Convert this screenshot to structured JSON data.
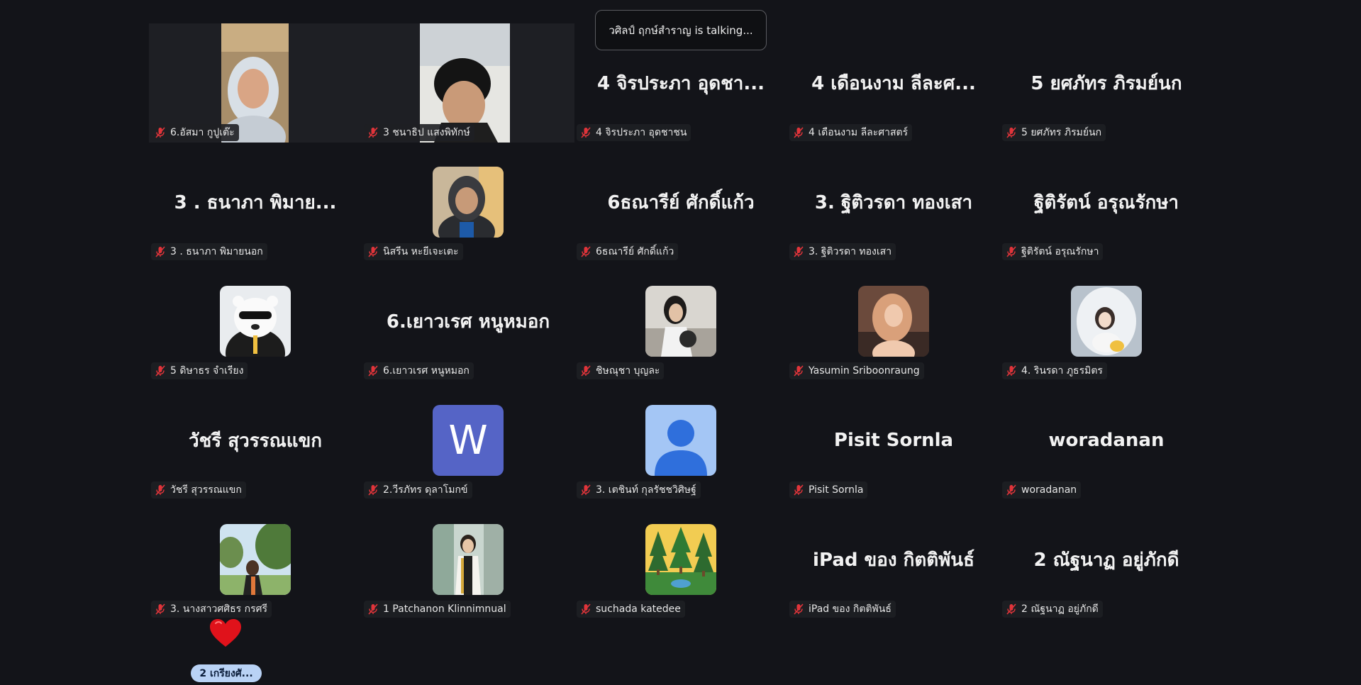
{
  "talking_banner": "วศิลป์ ฤกษ์สำราญ is talking...",
  "reaction_pill": "2 เกรียงศั...",
  "colors": {
    "background": "#131419",
    "mic_muted": "#e0343a"
  },
  "tiles": [
    {
      "label": "6.อัสมา กูปูเต๊ะ",
      "display_name": "",
      "avatar": "video-feed"
    },
    {
      "label": "3 ชนาธิป แสงพิทักษ์",
      "display_name": "",
      "avatar": "video-feed"
    },
    {
      "label": "4 จิรประภา อุดชาชน",
      "display_name": "4 จิรประภา อุดชา...",
      "avatar": "none"
    },
    {
      "label": "4 เดือนงาม ลีละศาสตร์",
      "display_name": "4 เดือนงาม ลีละศ...",
      "avatar": "none"
    },
    {
      "label": "5 ยศภัทร ภิรมย์นก",
      "display_name": "5 ยศภัทร ภิรมย์นก",
      "avatar": "none"
    },
    {
      "label": "3 . ธนาภา  พิมายนอก",
      "display_name": "3 . ธนาภา  พิมาย...",
      "avatar": "none"
    },
    {
      "label": "นิสรีน หะยีเจะเตะ",
      "display_name": "",
      "avatar": "photo-hijab"
    },
    {
      "label": "6ธณารีย์ ศักดิ์แก้ว",
      "display_name": "6ธณารีย์ ศักดิ์แก้ว",
      "avatar": "none"
    },
    {
      "label": "3. ฐิติวรดา ทองเสา",
      "display_name": "3. ฐิติวรดา ทองเสา",
      "avatar": "none"
    },
    {
      "label": "ฐิติรัตน์ อรุณรักษา",
      "display_name": "ฐิติรัตน์ อรุณรักษา",
      "avatar": "none"
    },
    {
      "label": "5 ดิษาธร จำเรียง",
      "display_name": "",
      "avatar": "cartoon-bear"
    },
    {
      "label": "6.เยาวเรศ หนูหมอก",
      "display_name": "6.เยาวเรศ หนูหมอก",
      "avatar": "none"
    },
    {
      "label": "ชิษณุชา บุญละ",
      "display_name": "",
      "avatar": "photo-student"
    },
    {
      "label": "Yasumin Sriboonraung",
      "display_name": "",
      "avatar": "photo-portrait"
    },
    {
      "label": "4. รินรดา ภูธรมิตร",
      "display_name": "",
      "avatar": "photo-mirror"
    },
    {
      "label": "วัชรี สุวรรณแขก",
      "display_name": "วัชรี สุวรรณแขก",
      "avatar": "none"
    },
    {
      "label": "2.วีรภัทร ดุลาโมกข์",
      "display_name": "",
      "avatar": "letter-w",
      "avatar_letter": "W"
    },
    {
      "label": "3. เตชินท์ กุลรัชชวิศิษฐ์",
      "display_name": "",
      "avatar": "default-person"
    },
    {
      "label": "Pisit Sornla",
      "display_name": "Pisit Sornla",
      "avatar": "none"
    },
    {
      "label": "woradanan",
      "display_name": "woradanan",
      "avatar": "none"
    },
    {
      "label": "3. นางสาวศศิธร  กรศรี",
      "display_name": "",
      "avatar": "photo-outdoor"
    },
    {
      "label": "1 Patchanon Klinnimnual",
      "display_name": "",
      "avatar": "photo-graduate"
    },
    {
      "label": "suchada katedee",
      "display_name": "",
      "avatar": "forest-art"
    },
    {
      "label": "iPad ของ กิตติพันธ์",
      "display_name": "iPad ของ กิตติพันธ์",
      "avatar": "none"
    },
    {
      "label": "2 ณัฐนาฏ อยู่ภักดี",
      "display_name": "2 ณัฐนาฏ อยู่ภักดี",
      "avatar": "none"
    }
  ]
}
